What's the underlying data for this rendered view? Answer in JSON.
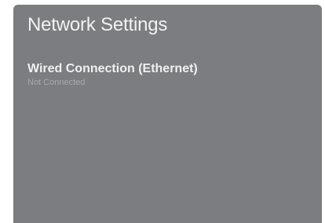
{
  "panel": {
    "title": "Network Settings",
    "background": "#7c7d80"
  },
  "connection": {
    "label": "Wired Connection (Ethernet)",
    "status": "Not Connected"
  }
}
